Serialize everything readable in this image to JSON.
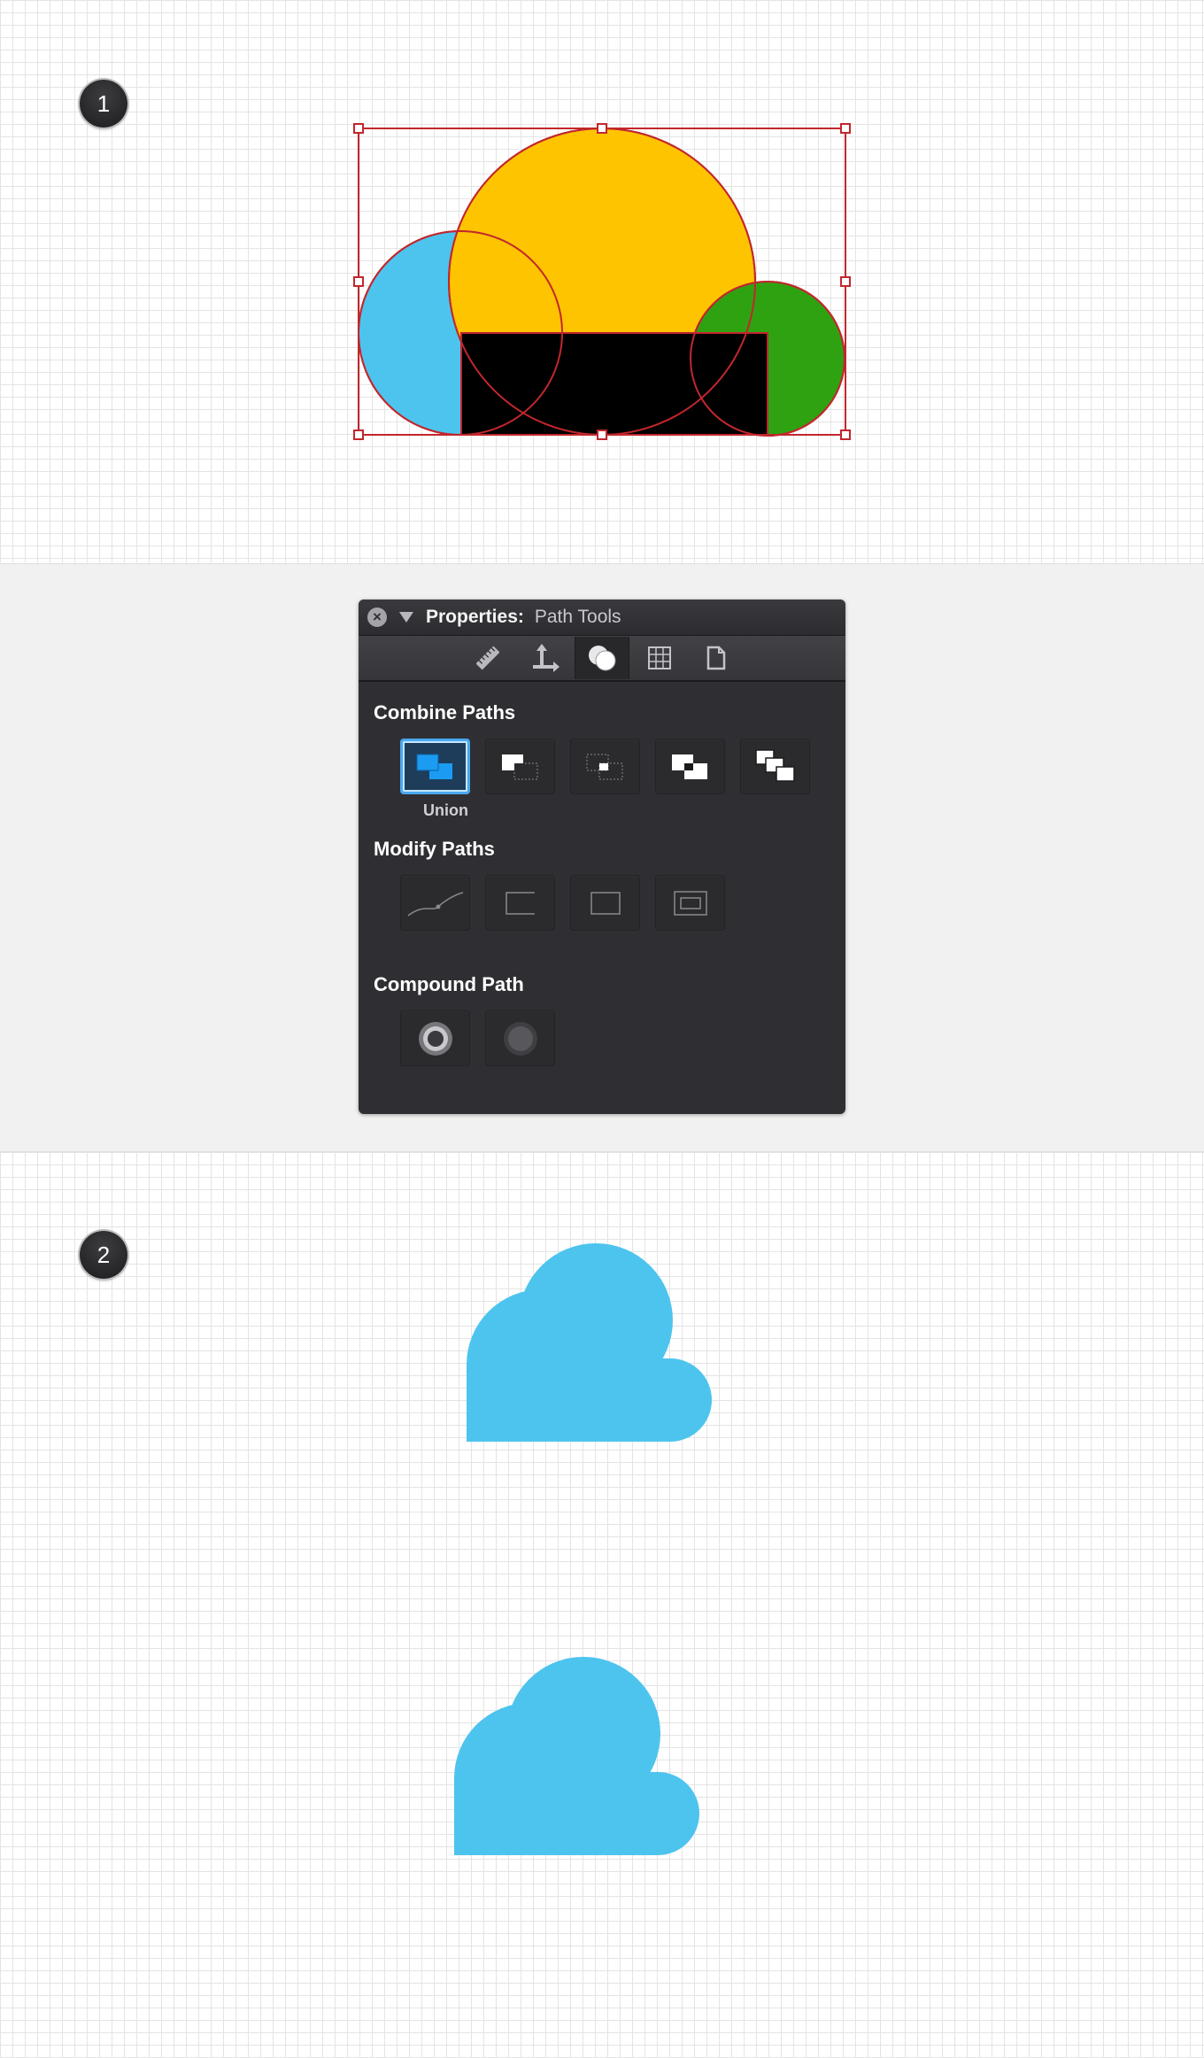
{
  "steps": {
    "step1": "1",
    "step2": "2"
  },
  "colors": {
    "shape_blue": "#4dc4ee",
    "shape_yellow": "#ffc400",
    "shape_green": "#2fa212",
    "shape_black": "#000000",
    "selection_red": "#c1272d",
    "accent_blue": "#4aa8f0"
  },
  "panel": {
    "title_label": "Properties:",
    "title_value": "Path Tools",
    "toolbar_icons": [
      "ruler-icon",
      "move-arrows-icon",
      "path-tools-circles-icon",
      "grid-icon",
      "document-icon"
    ],
    "active_tab": "path-tools-circles-icon",
    "combine_heading": "Combine Paths",
    "combine_buttons": [
      "union-icon",
      "subtract-icon",
      "intersect-icon",
      "exclude-icon",
      "divide-icon"
    ],
    "selected_button_caption": "Union",
    "modify_heading": "Modify Paths",
    "modify_buttons": [
      "curve-smooth-icon",
      "open-rect-icon",
      "rect-icon",
      "inset-rect-icon"
    ],
    "compound_heading": "Compound Path",
    "compound_buttons": [
      "make-compound-icon",
      "release-compound-icon"
    ]
  }
}
